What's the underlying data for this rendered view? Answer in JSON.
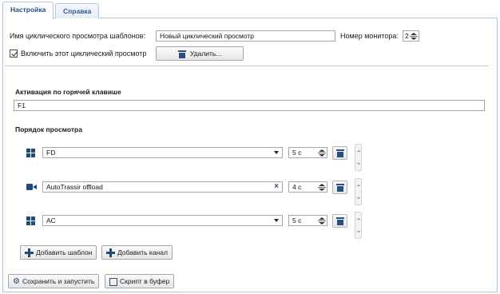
{
  "tabs": [
    {
      "label": "Настройка",
      "active": true
    },
    {
      "label": "Справка",
      "active": false
    }
  ],
  "settings": {
    "name_label": "Имя циклического просмотра шаблонов:",
    "name_value": "Новый циклический просмотр",
    "monitor_label": "Номер монитора:",
    "monitor_value": "2",
    "enable_label": "Включить этот циклический просмотр",
    "enable_checked": true,
    "delete_label": "Удалить..."
  },
  "hotkey": {
    "title": "Активация по горячей клавише",
    "value": "F1"
  },
  "order": {
    "title": "Порядок просмотра",
    "rows": [
      {
        "type": "template",
        "icon": "grid-icon",
        "value": "FD",
        "control": "dropdown",
        "duration": "5 с"
      },
      {
        "type": "channel",
        "icon": "camera-icon",
        "value": "AutoTrassir offload",
        "control": "clear",
        "duration": "4 с"
      },
      {
        "type": "template",
        "icon": "grid-icon",
        "value": "AC",
        "control": "dropdown",
        "duration": "5 с"
      }
    ],
    "add_template_label": "Добавить шаблон",
    "add_channel_label": "Добавить канал"
  },
  "footer": {
    "save_run_label": "Сохранить и запустить",
    "script_label": "Скрипт в буфер"
  },
  "colors": {
    "accent": "#1f4a7a",
    "tab_text": "#2e5c8f",
    "border": "#adc6e0"
  }
}
